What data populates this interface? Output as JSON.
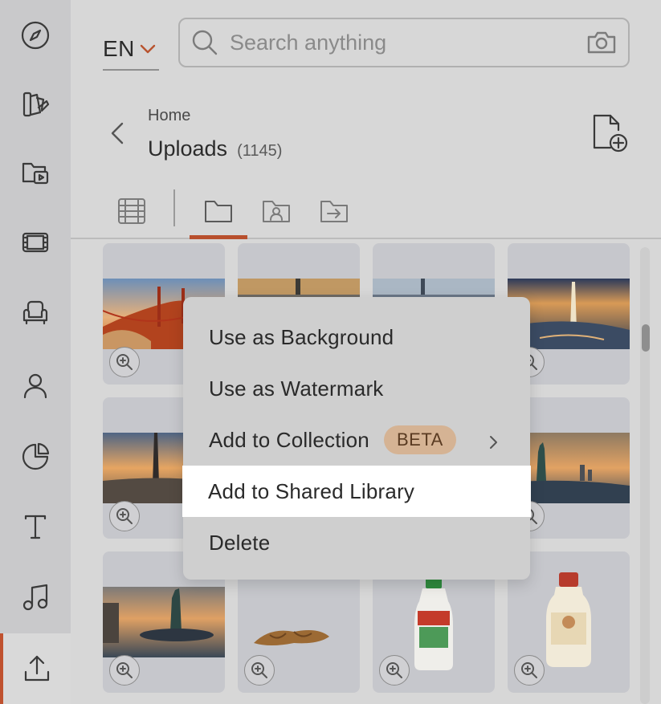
{
  "language": {
    "code": "EN"
  },
  "search": {
    "placeholder": "Search anything"
  },
  "breadcrumb": {
    "parent": "Home",
    "title": "Uploads",
    "count": "(1145)"
  },
  "rail": {
    "items": [
      {
        "icon": "compass-icon"
      },
      {
        "icon": "design-palette-icon"
      },
      {
        "icon": "video-folder-icon"
      },
      {
        "icon": "film-icon"
      },
      {
        "icon": "armchair-icon"
      },
      {
        "icon": "user-icon"
      },
      {
        "icon": "pie-chart-icon"
      },
      {
        "icon": "text-icon"
      },
      {
        "icon": "music-note-icon"
      },
      {
        "icon": "upload-icon",
        "active": true
      }
    ]
  },
  "tabs": [
    {
      "icon": "grid-icon"
    },
    {
      "icon": "folder-icon",
      "active": true
    },
    {
      "icon": "shared-folder-icon"
    },
    {
      "icon": "move-to-folder-icon"
    }
  ],
  "tiles": [
    {
      "subject": "golden-gate-bridge"
    },
    {
      "subject": "washington-monument-sunset"
    },
    {
      "subject": "washington-monument-dusk"
    },
    {
      "subject": "washington-monument-aerial"
    },
    {
      "subject": "washington-monument-river"
    },
    {
      "subject": "hidden"
    },
    {
      "subject": "hidden"
    },
    {
      "subject": "statue-of-liberty-sunset"
    },
    {
      "subject": "statue-of-liberty-island"
    },
    {
      "subject": "croissant"
    },
    {
      "subject": "salad-dressing-bottle"
    },
    {
      "subject": "mayonnaise-bottle"
    }
  ],
  "context_menu": {
    "items": [
      {
        "label": "Use as Background"
      },
      {
        "label": "Use as Watermark"
      },
      {
        "label": "Add to Collection",
        "badge": "BETA",
        "submenu": true
      },
      {
        "label": "Add to Shared Library",
        "highlighted": true
      },
      {
        "label": "Delete"
      }
    ]
  },
  "colors": {
    "accent": "#b84f2d",
    "beta_badge": "#d5b394",
    "highlight": "#ffffff"
  }
}
